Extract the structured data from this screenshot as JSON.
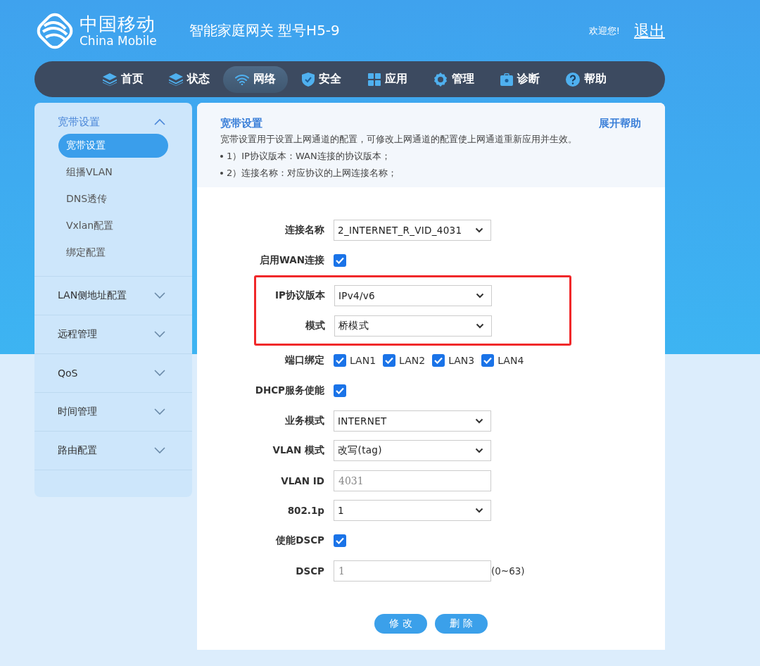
{
  "header": {
    "logo_cn": "中国移动",
    "logo_en": "China Mobile",
    "title": "智能家庭网关 型号H5-9",
    "welcome": "欢迎您!",
    "logout": "退出"
  },
  "nav": [
    {
      "label": "首页",
      "selected": false
    },
    {
      "label": "状态",
      "selected": false
    },
    {
      "label": "网络",
      "selected": true
    },
    {
      "label": "安全",
      "selected": false
    },
    {
      "label": "应用",
      "selected": false
    },
    {
      "label": "管理",
      "selected": false
    },
    {
      "label": "诊断",
      "selected": false
    },
    {
      "label": "帮助",
      "selected": false
    }
  ],
  "sidebar": {
    "groups": [
      {
        "label": "宽带设置",
        "expanded": true,
        "children": [
          {
            "label": "宽带设置",
            "selected": true
          },
          {
            "label": "组播VLAN",
            "selected": false
          },
          {
            "label": "DNS透传",
            "selected": false
          },
          {
            "label": "Vxlan配置",
            "selected": false
          },
          {
            "label": "绑定配置",
            "selected": false
          }
        ]
      },
      {
        "label": "LAN侧地址配置",
        "expanded": false
      },
      {
        "label": "远程管理",
        "expanded": false
      },
      {
        "label": "QoS",
        "expanded": false
      },
      {
        "label": "时间管理",
        "expanded": false
      },
      {
        "label": "路由配置",
        "expanded": false
      }
    ]
  },
  "panel": {
    "title": "宽带设置",
    "help_link": "展开帮助",
    "description": "宽带设置用于设置上网通道的配置，可修改上网通道的配置使上网通道重新应用并生效。",
    "bullets": [
      "1）IP协议版本：WAN连接的协议版本；",
      "2）连接名称：对应协议的上网连接名称；"
    ]
  },
  "form": {
    "rows": [
      {
        "kind": "select",
        "label": "连接名称",
        "value": "2_INTERNET_R_VID_4031",
        "highlighted": false
      },
      {
        "kind": "checkbox",
        "label": "启用WAN连接",
        "checked": true,
        "highlighted": false
      },
      {
        "kind": "select",
        "label": "IP协议版本",
        "value": "IPv4/v6",
        "highlighted": true
      },
      {
        "kind": "select",
        "label": "模式",
        "value": "桥模式",
        "highlighted": true
      },
      {
        "kind": "checkgroup",
        "label": "端口绑定",
        "options": [
          {
            "label": "LAN1",
            "checked": true
          },
          {
            "label": "LAN2",
            "checked": true
          },
          {
            "label": "LAN3",
            "checked": true
          },
          {
            "label": "LAN4",
            "checked": true
          }
        ],
        "highlighted": false
      },
      {
        "kind": "checkbox",
        "label": "DHCP服务使能",
        "checked": true,
        "highlighted": false
      },
      {
        "kind": "select",
        "label": "业务模式",
        "value": "INTERNET",
        "highlighted": false
      },
      {
        "kind": "select",
        "label": "VLAN 模式",
        "value": "改写(tag)",
        "highlighted": false
      },
      {
        "kind": "input",
        "label": "VLAN ID",
        "placeholder": "4031",
        "highlighted": false
      },
      {
        "kind": "select",
        "label": "802.1p",
        "value": "1",
        "highlighted": false
      },
      {
        "kind": "checkbox",
        "label": "使能DSCP",
        "checked": true,
        "highlighted": false
      },
      {
        "kind": "input",
        "label": "DSCP",
        "placeholder": "1",
        "suffix": "(0~63)",
        "highlighted": false
      }
    ],
    "buttons": [
      "修 改",
      "删 除"
    ]
  }
}
